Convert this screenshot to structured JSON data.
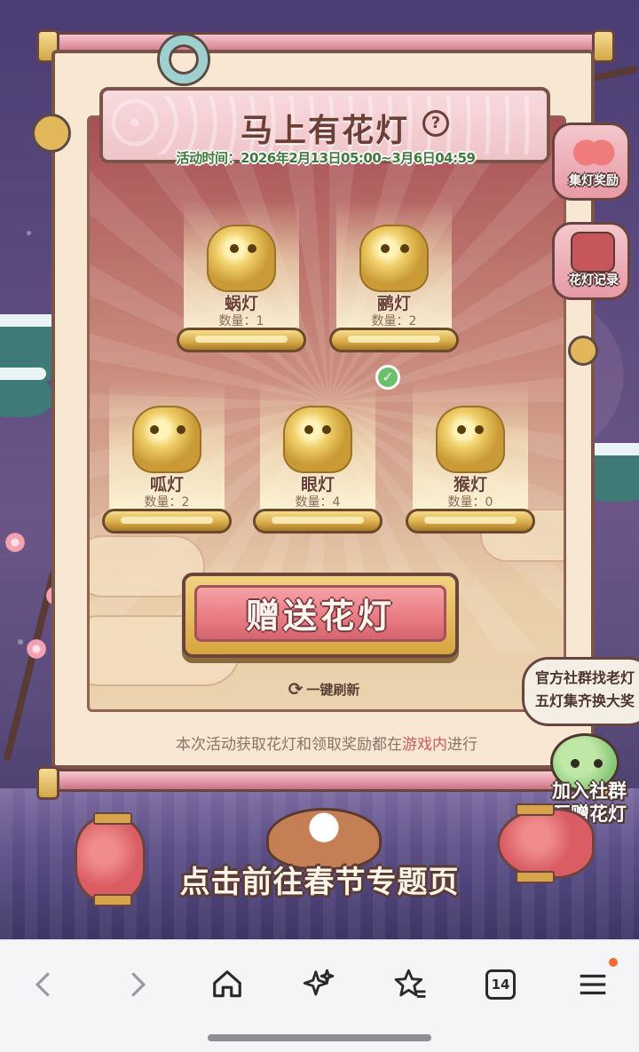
{
  "event": {
    "title": "马上有花灯",
    "help_icon": "?",
    "time_text": "活动时间：2026年2月13日05:00~3月6日04:59"
  },
  "lanterns": [
    {
      "name": "蜗灯",
      "qty": "数量：1",
      "icon": "snail-lantern-icon"
    },
    {
      "name": "鹂灯",
      "qty": "数量：2",
      "icon": "bird-lantern-icon"
    },
    {
      "name": "呱灯",
      "qty": "数量：2",
      "icon": "frog-lantern-icon"
    },
    {
      "name": "眼灯",
      "qty": "数量：4",
      "icon": "eye-beast-lantern-icon",
      "checked": true
    },
    {
      "name": "猴灯",
      "qty": "数量：0",
      "icon": "monkey-lantern-icon"
    }
  ],
  "actions": {
    "gift_button": "赠送花灯",
    "refresh": "一键刷新"
  },
  "footer": {
    "before": "本次活动获取花灯和领取奖励都在",
    "highlight": "游戏内",
    "after": "进行"
  },
  "side_buttons": {
    "collect_reward": "集灯奖励",
    "lantern_record": "花灯记录"
  },
  "community": {
    "speech_line1": "官方社群找老灯",
    "speech_line2": "五灯集齐换大奖",
    "join_line1": "加入社群",
    "join_line2": "互赠花灯"
  },
  "promo": "点击前往春节专题页",
  "browser_nav": {
    "tab_count": "14",
    "colors": {
      "accent_dot": "#f26a2d"
    }
  }
}
